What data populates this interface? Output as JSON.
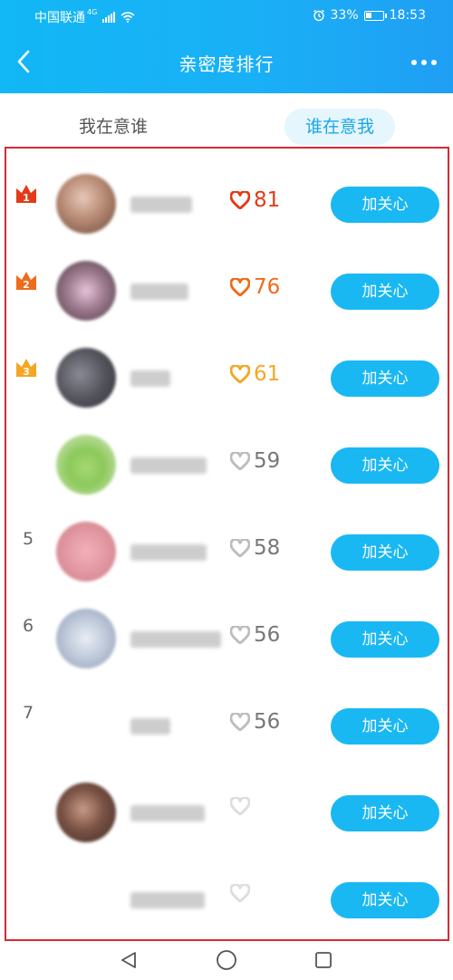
{
  "status_bar": {
    "carrier": "中国联通",
    "network": "4G",
    "battery": "33%",
    "battery_level": 0.33,
    "time": "18:53"
  },
  "header": {
    "title": "亲密度排行",
    "back_icon": "chevron-left-icon",
    "more_icon": "more-dots-icon"
  },
  "tabs": [
    {
      "label": "我在意谁",
      "active": false
    },
    {
      "label": "谁在意我",
      "active": true
    }
  ],
  "colors": {
    "header_blue": "#12b7f5",
    "active_tab_bg": "#e5f6fd",
    "active_tab_text": "#1aa8e8",
    "button_blue": "#19b8f3",
    "highlight_border": "#d42b34",
    "rank1": "#e33b17",
    "rank2": "#f06a1c",
    "rank3": "#f5a623",
    "score_gray": "#777777"
  },
  "list": {
    "items": [
      {
        "rank": "1",
        "score": "81",
        "heart_color": "#e33b17",
        "score_color": "#e33b17",
        "button": "加关心",
        "crown": true
      },
      {
        "rank": "2",
        "score": "76",
        "heart_color": "#f06a1c",
        "score_color": "#f06a1c",
        "button": "加关心",
        "crown": true
      },
      {
        "rank": "3",
        "score": "61",
        "heart_color": "#f5a623",
        "score_color": "#f5a623",
        "button": "加关心",
        "crown": true
      },
      {
        "rank": "",
        "score": "59",
        "heart_color": "#bdbdbd",
        "score_color": "#777777",
        "button": "加关心",
        "crown": false
      },
      {
        "rank": "5",
        "score": "58",
        "heart_color": "#bdbdbd",
        "score_color": "#777777",
        "button": "加关心",
        "crown": false
      },
      {
        "rank": "6",
        "score": "56",
        "heart_color": "#bdbdbd",
        "score_color": "#777777",
        "button": "加关心",
        "crown": false
      },
      {
        "rank": "7",
        "score": "56",
        "heart_color": "#bdbdbd",
        "score_color": "#777777",
        "button": "加关心",
        "crown": false
      },
      {
        "rank": "",
        "score": "",
        "heart_color": "#dddddd",
        "score_color": "#777777",
        "button": "加关心",
        "crown": false
      },
      {
        "rank": "",
        "score": "",
        "heart_color": "#dddddd",
        "score_color": "#777777",
        "button": "加关心",
        "crown": false
      }
    ]
  },
  "bottom_nav": {
    "back_icon": "triangle-back-icon",
    "home_icon": "circle-home-icon",
    "recent_icon": "square-recent-icon"
  }
}
